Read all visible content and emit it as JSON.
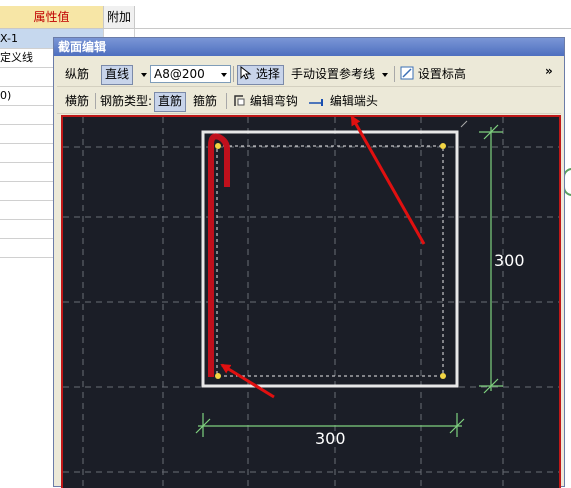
{
  "grid": {
    "header_value": "属性值",
    "header_extra": "附加",
    "rows": [
      "X-1",
      "定义线",
      "",
      "0)",
      "",
      "",
      "",
      "",
      "",
      "",
      "",
      ""
    ]
  },
  "dialog": {
    "title": "截面编辑",
    "toolbar1": {
      "longitudinal": "纵筋",
      "line_mode": "直线",
      "spec_value": "A8@200",
      "select": "选择",
      "ref_line": "手动设置参考线",
      "set_elevation": "设置标高",
      "more": "»"
    },
    "toolbar2": {
      "transverse": "横筋",
      "rebar_type_label": "钢筋类型:",
      "straight": "直筋",
      "stirrup": "箍筋",
      "edit_hook": "编辑弯钩",
      "edit_end": "编辑端头"
    },
    "canvas": {
      "dim_horizontal": "300",
      "dim_vertical": "300"
    }
  },
  "colors": {
    "canvas_bg": "#1b1e27",
    "canvas_border": "#c01818",
    "rebar": "#c0101c",
    "dimension": "#7fd17f",
    "section": "#e8e8e8",
    "annotation_arrow": "#e01010",
    "header_text": "#c00000"
  }
}
